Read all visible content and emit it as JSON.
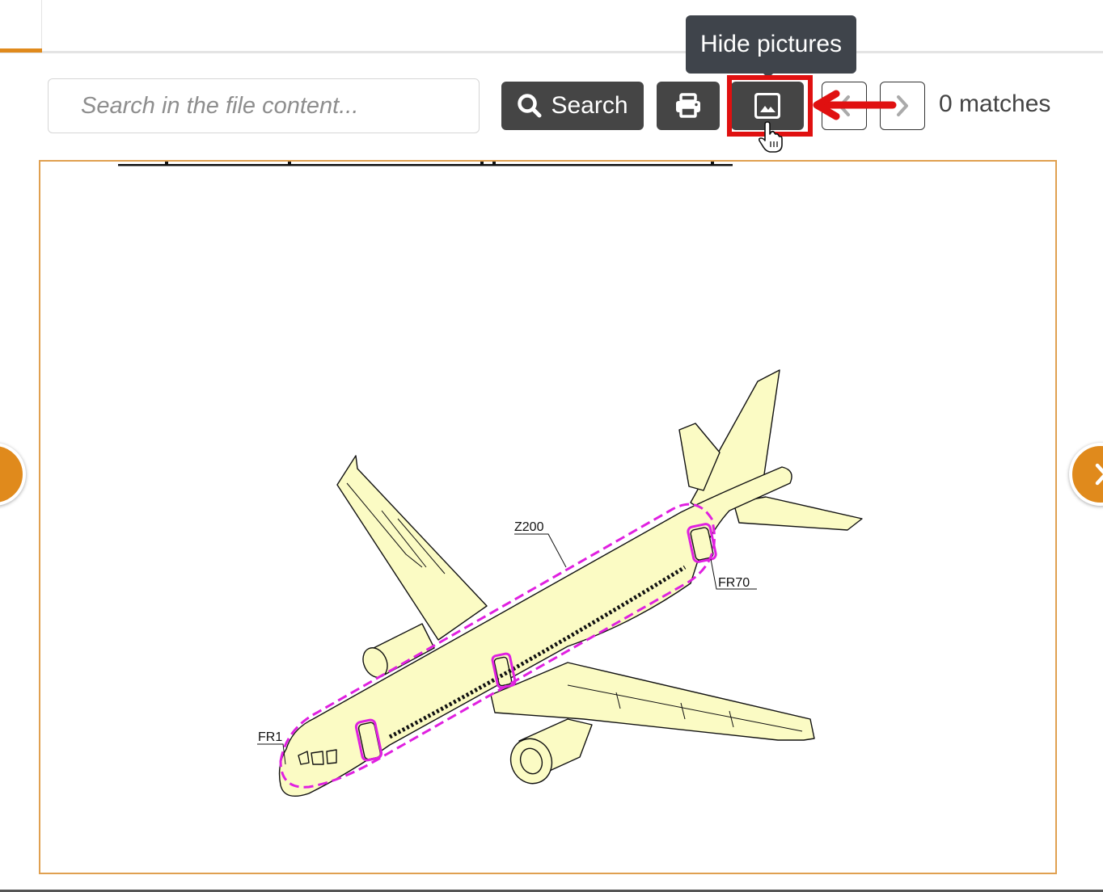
{
  "search": {
    "placeholder": "Search in the file content...",
    "button_label": "Search"
  },
  "toolbar": {
    "print_icon": "print-icon",
    "image_icon": "image-icon",
    "prev_icon": "chevron-left-icon",
    "next_icon": "chevron-right-icon"
  },
  "matches_text": "0 matches",
  "tooltip": {
    "text": "Hide pictures"
  },
  "figure": {
    "labels": {
      "z200": "Z200",
      "fr70": "FR70",
      "fr1": "FR1"
    }
  },
  "colors": {
    "accent": "#e08a1c",
    "highlight": "#e01010",
    "fuselage_fill": "#fbfbc4",
    "zone_outline": "#e020e0",
    "dark_button": "#454545",
    "tooltip_bg": "#3f444b"
  }
}
